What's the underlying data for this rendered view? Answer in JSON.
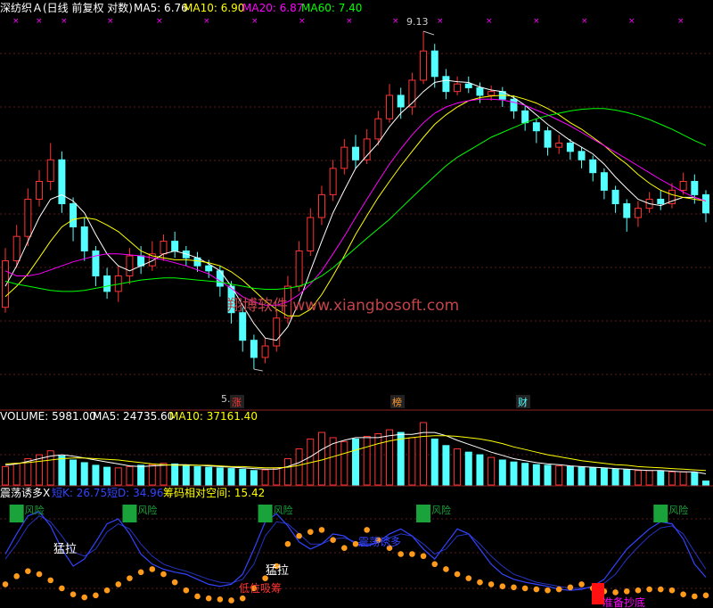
{
  "chart_data": [
    {
      "type": "candlestick",
      "title": "深纺织Ａ(日线 前复权 对数)",
      "ma_legend": [
        {
          "label": "MA5: 6.76",
          "color": "#ffffff"
        },
        {
          "label": "MA10: 6.90",
          "color": "#ffff00"
        },
        {
          "label": "MA20: 6.87",
          "color": "#ff00ff"
        },
        {
          "label": "MA60: 7.40",
          "color": "#00ff00"
        }
      ],
      "annotations": {
        "high": "9.13",
        "low": "5.35"
      },
      "event_tags": [
        "涨",
        "榜",
        "财"
      ],
      "watermark": "翔博软件 www.xiangbosoft.com",
      "colors": {
        "up": "#ff3333",
        "down": "#54ffff",
        "ma5": "#ffffff",
        "ma10": "#ffff00",
        "ma20": "#ff00ff",
        "ma60": "#00ff00"
      },
      "ohlc": [
        [
          5.9,
          6.35,
          6.48,
          5.85
        ],
        [
          6.35,
          6.6,
          6.72,
          6.28
        ],
        [
          6.6,
          7.0,
          7.12,
          6.5
        ],
        [
          7.0,
          7.2,
          7.33,
          6.92
        ],
        [
          7.2,
          7.45,
          7.65,
          7.1
        ],
        [
          7.45,
          6.95,
          7.55,
          6.85
        ],
        [
          6.95,
          6.7,
          7.02,
          6.55
        ],
        [
          6.7,
          6.45,
          6.8,
          6.35
        ],
        [
          6.45,
          6.2,
          6.5,
          6.1
        ],
        [
          6.2,
          6.05,
          6.28,
          5.98
        ],
        [
          6.05,
          6.2,
          6.3,
          5.95
        ],
        [
          6.2,
          6.4,
          6.48,
          6.12
        ],
        [
          6.4,
          6.3,
          6.5,
          6.22
        ],
        [
          6.3,
          6.42,
          6.55,
          6.25
        ],
        [
          6.42,
          6.55,
          6.62,
          6.35
        ],
        [
          6.55,
          6.45,
          6.65,
          6.38
        ],
        [
          6.45,
          6.38,
          6.5,
          6.3
        ],
        [
          6.38,
          6.3,
          6.44,
          6.24
        ],
        [
          6.3,
          6.25,
          6.36,
          6.18
        ],
        [
          6.25,
          6.1,
          6.3,
          6.0
        ],
        [
          6.1,
          5.85,
          6.15,
          5.75
        ],
        [
          5.85,
          5.6,
          5.9,
          5.5
        ],
        [
          5.6,
          5.45,
          5.65,
          5.35
        ],
        [
          5.45,
          5.55,
          5.62,
          5.4
        ],
        [
          5.55,
          5.8,
          5.88,
          5.5
        ],
        [
          5.8,
          6.1,
          6.2,
          5.75
        ],
        [
          6.1,
          6.45,
          6.55,
          6.05
        ],
        [
          6.45,
          6.8,
          6.9,
          6.4
        ],
        [
          6.8,
          7.05,
          7.15,
          6.72
        ],
        [
          7.05,
          7.35,
          7.45,
          6.98
        ],
        [
          7.35,
          7.6,
          7.7,
          7.28
        ],
        [
          7.6,
          7.45,
          7.75,
          7.35
        ],
        [
          7.45,
          7.7,
          7.82,
          7.4
        ],
        [
          7.7,
          7.95,
          8.05,
          7.62
        ],
        [
          7.95,
          8.25,
          8.4,
          7.9
        ],
        [
          8.25,
          8.1,
          8.35,
          7.95
        ],
        [
          8.1,
          8.45,
          8.55,
          8.0
        ],
        [
          8.45,
          8.85,
          9.13,
          8.4
        ],
        [
          8.85,
          8.5,
          8.95,
          8.35
        ],
        [
          8.5,
          8.3,
          8.6,
          8.2
        ],
        [
          8.3,
          8.4,
          8.5,
          8.25
        ],
        [
          8.4,
          8.35,
          8.5,
          8.28
        ],
        [
          8.35,
          8.25,
          8.42,
          8.15
        ],
        [
          8.25,
          8.3,
          8.38,
          8.18
        ],
        [
          8.3,
          8.2,
          8.36,
          8.1
        ],
        [
          8.2,
          8.05,
          8.25,
          7.95
        ],
        [
          8.05,
          7.9,
          8.12,
          7.8
        ],
        [
          7.9,
          7.8,
          7.95,
          7.65
        ],
        [
          7.8,
          7.6,
          7.85,
          7.5
        ],
        [
          7.6,
          7.65,
          7.75,
          7.52
        ],
        [
          7.65,
          7.55,
          7.7,
          7.45
        ],
        [
          7.55,
          7.45,
          7.6,
          7.35
        ],
        [
          7.45,
          7.3,
          7.5,
          7.2
        ],
        [
          7.3,
          7.1,
          7.35,
          7.0
        ],
        [
          7.1,
          6.95,
          7.15,
          6.85
        ],
        [
          6.95,
          6.8,
          7.0,
          6.65
        ],
        [
          6.8,
          6.9,
          6.98,
          6.7
        ],
        [
          6.9,
          7.0,
          7.08,
          6.85
        ],
        [
          7.0,
          6.95,
          7.1,
          6.88
        ],
        [
          6.95,
          7.1,
          7.18,
          6.9
        ],
        [
          7.1,
          7.2,
          7.3,
          7.05
        ],
        [
          7.2,
          7.05,
          7.28,
          6.95
        ],
        [
          7.05,
          6.85,
          7.1,
          6.75
        ]
      ],
      "ma": {
        "ma5": [
          6.1,
          6.3,
          6.55,
          6.8,
          7.0,
          7.05,
          6.98,
          6.85,
          6.62,
          6.42,
          6.3,
          6.25,
          6.3,
          6.35,
          6.42,
          6.45,
          6.42,
          6.38,
          6.32,
          6.25,
          6.1,
          5.92,
          5.75,
          5.62,
          5.6,
          5.72,
          5.95,
          6.25,
          6.55,
          6.85,
          7.1,
          7.35,
          7.5,
          7.65,
          7.85,
          8.02,
          8.15,
          8.3,
          8.42,
          8.45,
          8.43,
          8.42,
          8.36,
          8.32,
          8.3,
          8.22,
          8.12,
          8.0,
          7.88,
          7.78,
          7.68,
          7.6,
          7.52,
          7.4,
          7.25,
          7.12,
          7.0,
          6.95,
          6.93,
          6.98,
          7.02,
          7.02,
          6.98
        ],
        "ma10": [
          6.0,
          6.1,
          6.22,
          6.38,
          6.55,
          6.7,
          6.78,
          6.8,
          6.78,
          6.72,
          6.65,
          6.55,
          6.45,
          6.4,
          6.38,
          6.36,
          6.36,
          6.35,
          6.33,
          6.3,
          6.24,
          6.16,
          6.06,
          5.96,
          5.88,
          5.82,
          5.82,
          5.88,
          6.02,
          6.2,
          6.4,
          6.62,
          6.82,
          7.02,
          7.2,
          7.38,
          7.55,
          7.72,
          7.88,
          8.0,
          8.1,
          8.18,
          8.22,
          8.24,
          8.25,
          8.24,
          8.2,
          8.15,
          8.08,
          8.0,
          7.9,
          7.82,
          7.72,
          7.62,
          7.5,
          7.4,
          7.28,
          7.18,
          7.1,
          7.05,
          7.02,
          7.0,
          6.98
        ],
        "ma20": [
          6.25,
          6.2,
          6.2,
          6.22,
          6.26,
          6.3,
          6.34,
          6.37,
          6.4,
          6.42,
          6.42,
          6.41,
          6.4,
          6.38,
          6.36,
          6.33,
          6.3,
          6.26,
          6.22,
          6.15,
          6.08,
          6.0,
          5.95,
          5.92,
          5.92,
          5.95,
          6.02,
          6.12,
          6.25,
          6.42,
          6.6,
          6.8,
          7.0,
          7.2,
          7.4,
          7.58,
          7.75,
          7.9,
          8.02,
          8.1,
          8.15,
          8.18,
          8.2,
          8.2,
          8.19,
          8.16,
          8.12,
          8.06,
          8.0,
          7.93,
          7.86,
          7.78,
          7.7,
          7.62,
          7.54,
          7.46,
          7.38,
          7.3,
          7.22,
          7.15,
          7.08,
          7.02,
          6.98
        ],
        "ma60": [
          6.15,
          6.12,
          6.1,
          6.08,
          6.06,
          6.05,
          6.05,
          6.06,
          6.08,
          6.1,
          6.12,
          6.14,
          6.16,
          6.17,
          6.18,
          6.18,
          6.17,
          6.16,
          6.15,
          6.14,
          6.12,
          6.1,
          6.08,
          6.07,
          6.07,
          6.08,
          6.1,
          6.14,
          6.2,
          6.28,
          6.38,
          6.48,
          6.58,
          6.68,
          6.78,
          6.9,
          7.02,
          7.14,
          7.26,
          7.38,
          7.48,
          7.56,
          7.64,
          7.72,
          7.78,
          7.84,
          7.9,
          7.95,
          7.99,
          8.02,
          8.05,
          8.07,
          8.08,
          8.08,
          8.06,
          8.03,
          7.99,
          7.94,
          7.88,
          7.82,
          7.75,
          7.68,
          7.62
        ]
      }
    },
    {
      "type": "bar",
      "legend": [
        {
          "label": "VOLUME: 5981.00",
          "color": "#ffffff"
        },
        {
          "label": "MA5: 24735.60",
          "color": "#ffffff"
        },
        {
          "label": "MA10: 37161.40",
          "color": "#ffff00"
        }
      ],
      "values": [
        28,
        33,
        40,
        46,
        52,
        44,
        38,
        34,
        30,
        27,
        26,
        28,
        30,
        31,
        33,
        32,
        30,
        28,
        27,
        26,
        25,
        24,
        22,
        23,
        26,
        40,
        55,
        70,
        80,
        72,
        66,
        70,
        74,
        78,
        84,
        80,
        72,
        95,
        70,
        60,
        55,
        50,
        46,
        42,
        38,
        35,
        33,
        31,
        30,
        29,
        28,
        27,
        26,
        25,
        24,
        23,
        22,
        22,
        21,
        20,
        20,
        19,
        6
      ],
      "ma5": [
        30,
        32,
        36,
        40,
        44,
        46,
        44,
        41,
        38,
        35,
        32,
        29,
        28,
        29,
        30,
        31,
        31,
        30,
        29,
        28,
        27,
        26,
        25,
        24,
        24,
        28,
        34,
        43,
        54,
        63,
        68,
        72,
        72,
        72,
        75,
        77,
        77,
        80,
        80,
        75,
        68,
        62,
        56,
        50,
        45,
        40,
        37,
        34,
        32,
        31,
        29,
        28,
        27,
        26,
        25,
        24,
        23,
        22,
        22,
        21,
        20,
        20,
        17
      ],
      "ma10": [
        32,
        33,
        34,
        36,
        38,
        40,
        41,
        41,
        40,
        39,
        38,
        36,
        34,
        32,
        31,
        30,
        30,
        30,
        30,
        29,
        28,
        28,
        27,
        26,
        26,
        27,
        30,
        34,
        38,
        43,
        48,
        53,
        58,
        63,
        67,
        70,
        72,
        74,
        75,
        75,
        74,
        72,
        70,
        67,
        63,
        58,
        54,
        50,
        46,
        43,
        40,
        37,
        35,
        33,
        31,
        30,
        28,
        27,
        26,
        25,
        24,
        23,
        22
      ],
      "colors": {
        "up": "#ff3333",
        "down": "#54ffff"
      }
    },
    {
      "type": "line",
      "title": "震荡诱多X",
      "legend": [
        {
          "label": "短K: 26.75",
          "color": "#3344ff"
        },
        {
          "label": "短D: 34.96",
          "color": "#3344ff"
        },
        {
          "label": "筹码相对空间: 15.42",
          "color": "#ffff00"
        }
      ],
      "labels": [
        "风险",
        "猛拉",
        "低位吸筹",
        "震荡诱多",
        "准备抄底"
      ],
      "k": [
        50,
        70,
        88,
        92,
        78,
        55,
        38,
        45,
        62,
        80,
        85,
        70,
        50,
        40,
        35,
        32,
        30,
        25,
        20,
        18,
        20,
        30,
        55,
        82,
        90,
        78,
        62,
        55,
        60,
        70,
        68,
        60,
        58,
        62,
        70,
        75,
        68,
        55,
        45,
        60,
        75,
        70,
        55,
        40,
        30,
        25,
        22,
        20,
        18,
        15,
        14,
        15,
        18,
        25,
        40,
        55,
        65,
        75,
        82,
        80,
        65,
        40,
        27
      ],
      "d": [
        45,
        60,
        78,
        88,
        82,
        68,
        52,
        48,
        55,
        72,
        80,
        75,
        60,
        48,
        40,
        36,
        33,
        29,
        25,
        22,
        21,
        25,
        40,
        68,
        82,
        80,
        70,
        60,
        60,
        65,
        66,
        62,
        60,
        61,
        66,
        70,
        68,
        60,
        50,
        55,
        68,
        70,
        60,
        48,
        38,
        30,
        26,
        22,
        20,
        18,
        16,
        16,
        17,
        21,
        30,
        45,
        57,
        68,
        76,
        78,
        70,
        52,
        35
      ],
      "chip": [
        20,
        28,
        33,
        30,
        24,
        16,
        10,
        7,
        9,
        14,
        20,
        26,
        32,
        35,
        30,
        22,
        14,
        8,
        6,
        5,
        4,
        6,
        16,
        26,
        38,
        60,
        68,
        72,
        74,
        64,
        56,
        60,
        74,
        64,
        56,
        50,
        50,
        48,
        40,
        35,
        30,
        26,
        22,
        20,
        18,
        17,
        16,
        15,
        14,
        15,
        17,
        20,
        16,
        13,
        12,
        13,
        14,
        15,
        15,
        14,
        10,
        8,
        9
      ],
      "risk_signals": [
        1,
        11,
        23,
        37,
        58
      ]
    }
  ]
}
